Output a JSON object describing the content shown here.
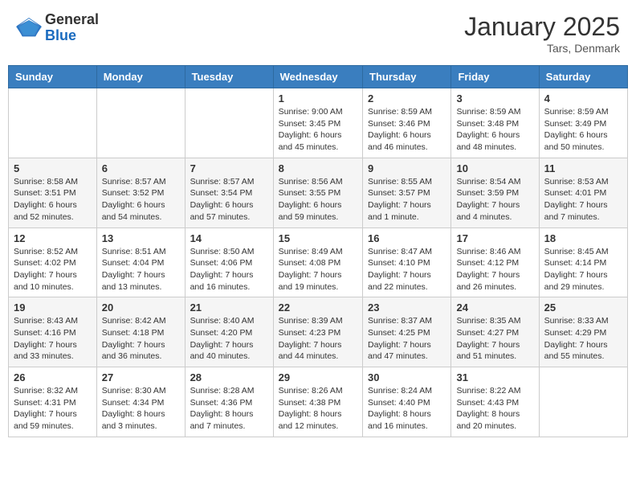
{
  "header": {
    "logo_general": "General",
    "logo_blue": "Blue",
    "month_title": "January 2025",
    "location": "Tars, Denmark"
  },
  "days_of_week": [
    "Sunday",
    "Monday",
    "Tuesday",
    "Wednesday",
    "Thursday",
    "Friday",
    "Saturday"
  ],
  "weeks": [
    [
      {
        "day": "",
        "info": ""
      },
      {
        "day": "",
        "info": ""
      },
      {
        "day": "",
        "info": ""
      },
      {
        "day": "1",
        "info": "Sunrise: 9:00 AM\nSunset: 3:45 PM\nDaylight: 6 hours\nand 45 minutes."
      },
      {
        "day": "2",
        "info": "Sunrise: 8:59 AM\nSunset: 3:46 PM\nDaylight: 6 hours\nand 46 minutes."
      },
      {
        "day": "3",
        "info": "Sunrise: 8:59 AM\nSunset: 3:48 PM\nDaylight: 6 hours\nand 48 minutes."
      },
      {
        "day": "4",
        "info": "Sunrise: 8:59 AM\nSunset: 3:49 PM\nDaylight: 6 hours\nand 50 minutes."
      }
    ],
    [
      {
        "day": "5",
        "info": "Sunrise: 8:58 AM\nSunset: 3:51 PM\nDaylight: 6 hours\nand 52 minutes."
      },
      {
        "day": "6",
        "info": "Sunrise: 8:57 AM\nSunset: 3:52 PM\nDaylight: 6 hours\nand 54 minutes."
      },
      {
        "day": "7",
        "info": "Sunrise: 8:57 AM\nSunset: 3:54 PM\nDaylight: 6 hours\nand 57 minutes."
      },
      {
        "day": "8",
        "info": "Sunrise: 8:56 AM\nSunset: 3:55 PM\nDaylight: 6 hours\nand 59 minutes."
      },
      {
        "day": "9",
        "info": "Sunrise: 8:55 AM\nSunset: 3:57 PM\nDaylight: 7 hours\nand 1 minute."
      },
      {
        "day": "10",
        "info": "Sunrise: 8:54 AM\nSunset: 3:59 PM\nDaylight: 7 hours\nand 4 minutes."
      },
      {
        "day": "11",
        "info": "Sunrise: 8:53 AM\nSunset: 4:01 PM\nDaylight: 7 hours\nand 7 minutes."
      }
    ],
    [
      {
        "day": "12",
        "info": "Sunrise: 8:52 AM\nSunset: 4:02 PM\nDaylight: 7 hours\nand 10 minutes."
      },
      {
        "day": "13",
        "info": "Sunrise: 8:51 AM\nSunset: 4:04 PM\nDaylight: 7 hours\nand 13 minutes."
      },
      {
        "day": "14",
        "info": "Sunrise: 8:50 AM\nSunset: 4:06 PM\nDaylight: 7 hours\nand 16 minutes."
      },
      {
        "day": "15",
        "info": "Sunrise: 8:49 AM\nSunset: 4:08 PM\nDaylight: 7 hours\nand 19 minutes."
      },
      {
        "day": "16",
        "info": "Sunrise: 8:47 AM\nSunset: 4:10 PM\nDaylight: 7 hours\nand 22 minutes."
      },
      {
        "day": "17",
        "info": "Sunrise: 8:46 AM\nSunset: 4:12 PM\nDaylight: 7 hours\nand 26 minutes."
      },
      {
        "day": "18",
        "info": "Sunrise: 8:45 AM\nSunset: 4:14 PM\nDaylight: 7 hours\nand 29 minutes."
      }
    ],
    [
      {
        "day": "19",
        "info": "Sunrise: 8:43 AM\nSunset: 4:16 PM\nDaylight: 7 hours\nand 33 minutes."
      },
      {
        "day": "20",
        "info": "Sunrise: 8:42 AM\nSunset: 4:18 PM\nDaylight: 7 hours\nand 36 minutes."
      },
      {
        "day": "21",
        "info": "Sunrise: 8:40 AM\nSunset: 4:20 PM\nDaylight: 7 hours\nand 40 minutes."
      },
      {
        "day": "22",
        "info": "Sunrise: 8:39 AM\nSunset: 4:23 PM\nDaylight: 7 hours\nand 44 minutes."
      },
      {
        "day": "23",
        "info": "Sunrise: 8:37 AM\nSunset: 4:25 PM\nDaylight: 7 hours\nand 47 minutes."
      },
      {
        "day": "24",
        "info": "Sunrise: 8:35 AM\nSunset: 4:27 PM\nDaylight: 7 hours\nand 51 minutes."
      },
      {
        "day": "25",
        "info": "Sunrise: 8:33 AM\nSunset: 4:29 PM\nDaylight: 7 hours\nand 55 minutes."
      }
    ],
    [
      {
        "day": "26",
        "info": "Sunrise: 8:32 AM\nSunset: 4:31 PM\nDaylight: 7 hours\nand 59 minutes."
      },
      {
        "day": "27",
        "info": "Sunrise: 8:30 AM\nSunset: 4:34 PM\nDaylight: 8 hours\nand 3 minutes."
      },
      {
        "day": "28",
        "info": "Sunrise: 8:28 AM\nSunset: 4:36 PM\nDaylight: 8 hours\nand 7 minutes."
      },
      {
        "day": "29",
        "info": "Sunrise: 8:26 AM\nSunset: 4:38 PM\nDaylight: 8 hours\nand 12 minutes."
      },
      {
        "day": "30",
        "info": "Sunrise: 8:24 AM\nSunset: 4:40 PM\nDaylight: 8 hours\nand 16 minutes."
      },
      {
        "day": "31",
        "info": "Sunrise: 8:22 AM\nSunset: 4:43 PM\nDaylight: 8 hours\nand 20 minutes."
      },
      {
        "day": "",
        "info": ""
      }
    ]
  ]
}
